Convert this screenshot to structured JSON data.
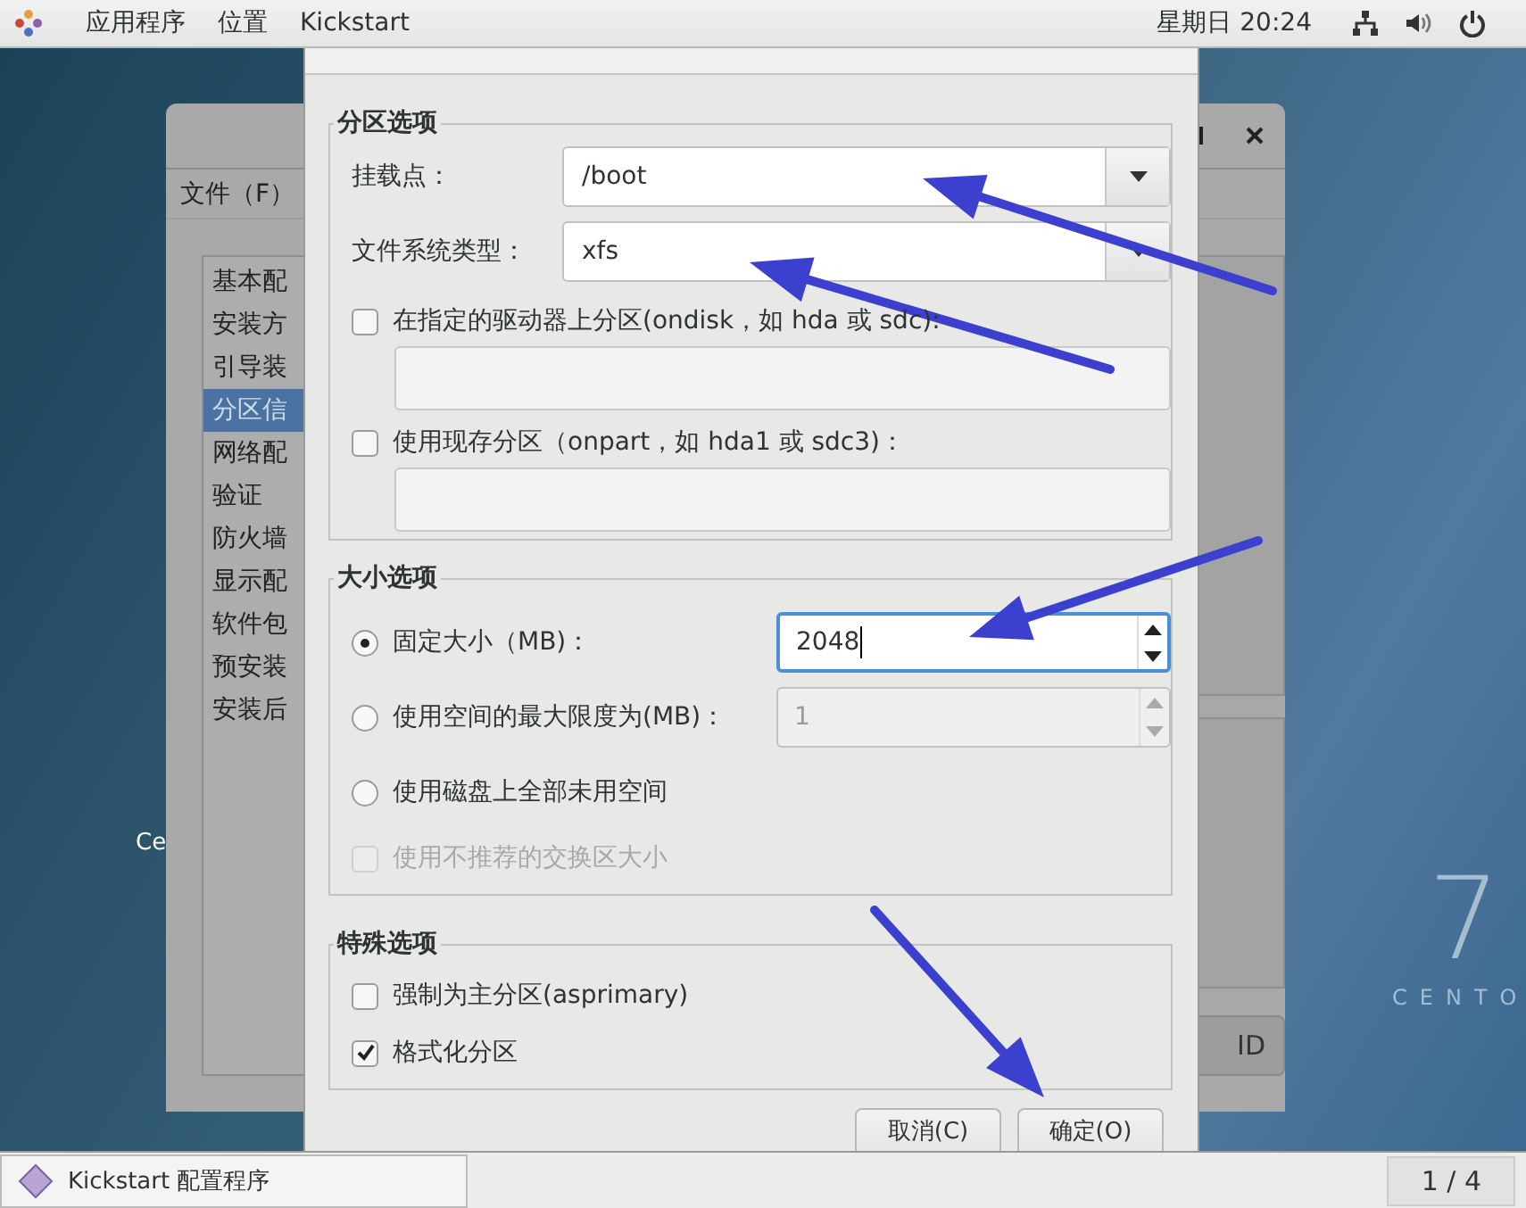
{
  "top_bar": {
    "menus": [
      "应用程序",
      "位置",
      "Kickstart"
    ],
    "clock": "星期日 20:24"
  },
  "desktop": {
    "icon_label": "Ce",
    "logo_number": "7",
    "logo_text": "CENTO"
  },
  "main_window": {
    "menu": [
      "文件（F）"
    ],
    "sidebar": [
      {
        "label": "基本配",
        "selected": false
      },
      {
        "label": "安装方",
        "selected": false
      },
      {
        "label": "引导装",
        "selected": false
      },
      {
        "label": "分区信",
        "selected": true
      },
      {
        "label": "网络配",
        "selected": false
      },
      {
        "label": "验证",
        "selected": false
      },
      {
        "label": "防火墙",
        "selected": false
      },
      {
        "label": "显示配",
        "selected": false
      },
      {
        "label": "软件包",
        "selected": false
      },
      {
        "label": "预安装",
        "selected": false
      },
      {
        "label": "安装后",
        "selected": false
      }
    ],
    "button": "ID"
  },
  "dialog": {
    "partition": {
      "title": "分区选项",
      "mount_point": {
        "label": "挂载点：",
        "value": "/boot"
      },
      "fs_type": {
        "label": "文件系统类型：",
        "value": "xfs"
      },
      "ondisk": {
        "label": "在指定的驱动器上分区(ondisk，如  hda 或  sdc):",
        "checked": false
      },
      "onpart": {
        "label": "使用现存分区（onpart，如  hda1 或  sdc3)：",
        "checked": false
      }
    },
    "size": {
      "title": "大小选项",
      "options": [
        {
          "kind": "radio",
          "label": "固定大小（MB)：",
          "selected": true,
          "spin": {
            "value": "2048",
            "disabled": false,
            "focused": true
          }
        },
        {
          "kind": "radio",
          "label": "使用空间的最大限度为(MB)：",
          "selected": false,
          "spin": {
            "value": "1",
            "disabled": true,
            "focused": false
          }
        },
        {
          "kind": "radio",
          "label": "使用磁盘上全部未用空间",
          "selected": false
        },
        {
          "kind": "checkbox",
          "label": "使用不推荐的交换区大小",
          "checked": false,
          "disabled": true
        }
      ]
    },
    "special": {
      "title": "特殊选项",
      "items": [
        {
          "label": "强制为主分区(asprimary)",
          "checked": false
        },
        {
          "label": "格式化分区",
          "checked": true
        }
      ]
    },
    "buttons": [
      "取消(C)",
      "确定(O)"
    ]
  },
  "taskbar": {
    "task": "Kickstart 配置程序",
    "workspace": "1 / 4"
  }
}
